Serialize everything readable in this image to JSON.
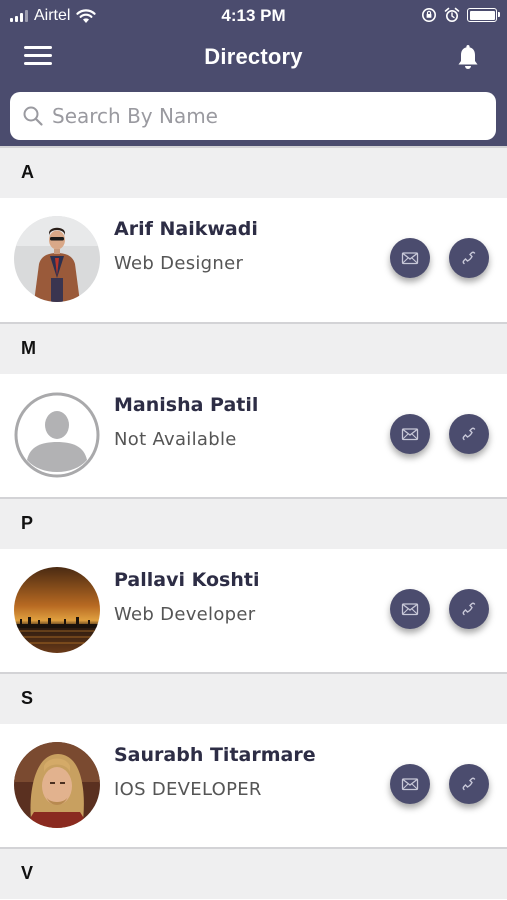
{
  "status_bar": {
    "carrier": "Airtel",
    "time": "4:13 PM"
  },
  "nav": {
    "title": "Directory",
    "menu_icon": "hamburger-menu-icon",
    "bell_icon": "bell-icon"
  },
  "search": {
    "placeholder": "Search By Name",
    "value": ""
  },
  "sections": [
    {
      "letter": "A",
      "contacts": [
        {
          "name": "Arif Naikwadi",
          "role": "Web Designer",
          "avatar": "photo"
        }
      ]
    },
    {
      "letter": "M",
      "contacts": [
        {
          "name": "Manisha Patil",
          "role": "Not Available",
          "avatar": "placeholder"
        }
      ]
    },
    {
      "letter": "P",
      "contacts": [
        {
          "name": "Pallavi Koshti",
          "role": "Web Developer",
          "avatar": "photo"
        }
      ]
    },
    {
      "letter": "S",
      "contacts": [
        {
          "name": "Saurabh Titarmare",
          "role": "IOS DEVELOPER",
          "avatar": "photo"
        }
      ]
    },
    {
      "letter": "V",
      "contacts": []
    }
  ],
  "colors": {
    "header_bg": "#4b4c6e",
    "action_button_bg": "#4b4c6e",
    "section_bg": "#efeff0",
    "name_text": "#2d2d45"
  }
}
